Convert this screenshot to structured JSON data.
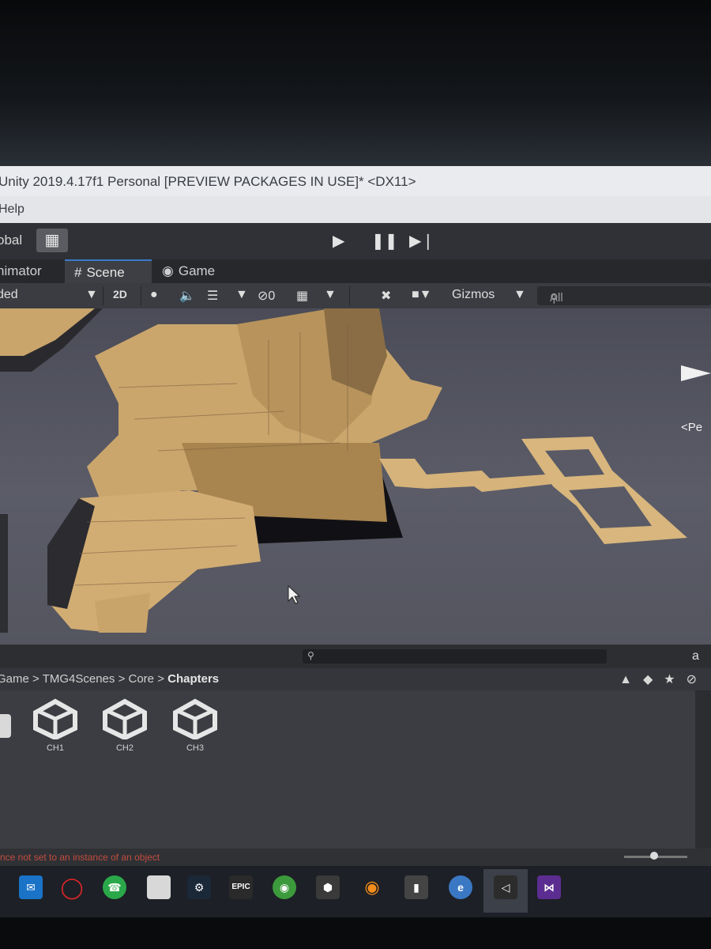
{
  "window": {
    "title": "Unity 2019.4.17f1 Personal [PREVIEW PACKAGES IN USE]* <DX11>",
    "menu_help": "Help"
  },
  "toolbar": {
    "global_label": "obal",
    "grid_icon": "grid-snap-icon",
    "play_icon": "play-icon",
    "pause_icon": "pause-icon",
    "step_icon": "step-icon"
  },
  "tabs": {
    "animator": "nimator",
    "scene": "Scene",
    "game": "Game"
  },
  "scene_toolbar": {
    "shading_mode": "ded",
    "mode_2d": "2D",
    "hidden_count": "0",
    "gizmos_label": "Gizmos",
    "search_placeholder": "All"
  },
  "viewport": {
    "persp_label": "<Pe"
  },
  "project": {
    "breadcrumb": [
      "Game",
      "TMG4Scenes",
      "Core",
      "Chapters"
    ],
    "assets": [
      {
        "label": "CH1",
        "icon": "unity-scene-icon"
      },
      {
        "label": "CH2",
        "icon": "unity-scene-icon"
      },
      {
        "label": "CH3",
        "icon": "unity-scene-icon"
      }
    ]
  },
  "console": {
    "error_message": "nce not set to an instance of an object"
  },
  "taskbar": {
    "icons": [
      "outlook-icon",
      "opera-icon",
      "whatsapp-icon",
      "folder-icon",
      "steam-icon",
      "epic-games-icon",
      "chrome-icon",
      "unity-hub-icon",
      "blender-icon",
      "app-icon",
      "edge-icon",
      "unity-icon",
      "visual-studio-icon"
    ],
    "epic_label": "EPIC"
  },
  "colors": {
    "accent_tab": "#3a79c9",
    "sand": "#d9b57a",
    "error_text": "#c44c3e"
  }
}
